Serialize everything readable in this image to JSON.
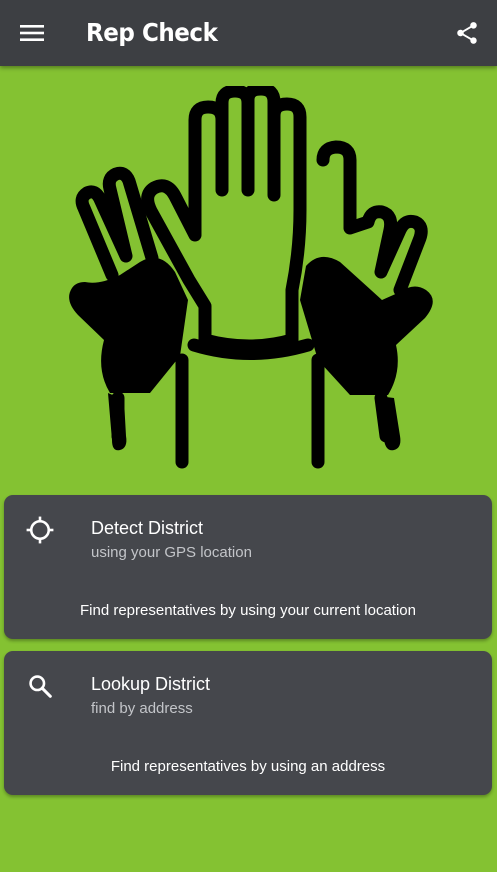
{
  "app_bar": {
    "title": "Rep Check",
    "menu_icon": "hamburger-menu-icon",
    "share_icon": "share-icon",
    "background_color": "#3D3F43"
  },
  "hero": {
    "icon": "raised-hands-icon"
  },
  "cards": [
    {
      "icon": "gps-crosshair-icon",
      "title": "Detect District",
      "subtitle": "using your GPS location",
      "description": "Find representatives by using your current location"
    },
    {
      "icon": "search-icon",
      "title": "Lookup District",
      "subtitle": "find by address",
      "description": "Find representatives by using an address"
    }
  ],
  "colors": {
    "background": "#84C232",
    "card": "#45474C",
    "text_primary": "#FFFFFF",
    "text_secondary": "#C3C5C9"
  }
}
